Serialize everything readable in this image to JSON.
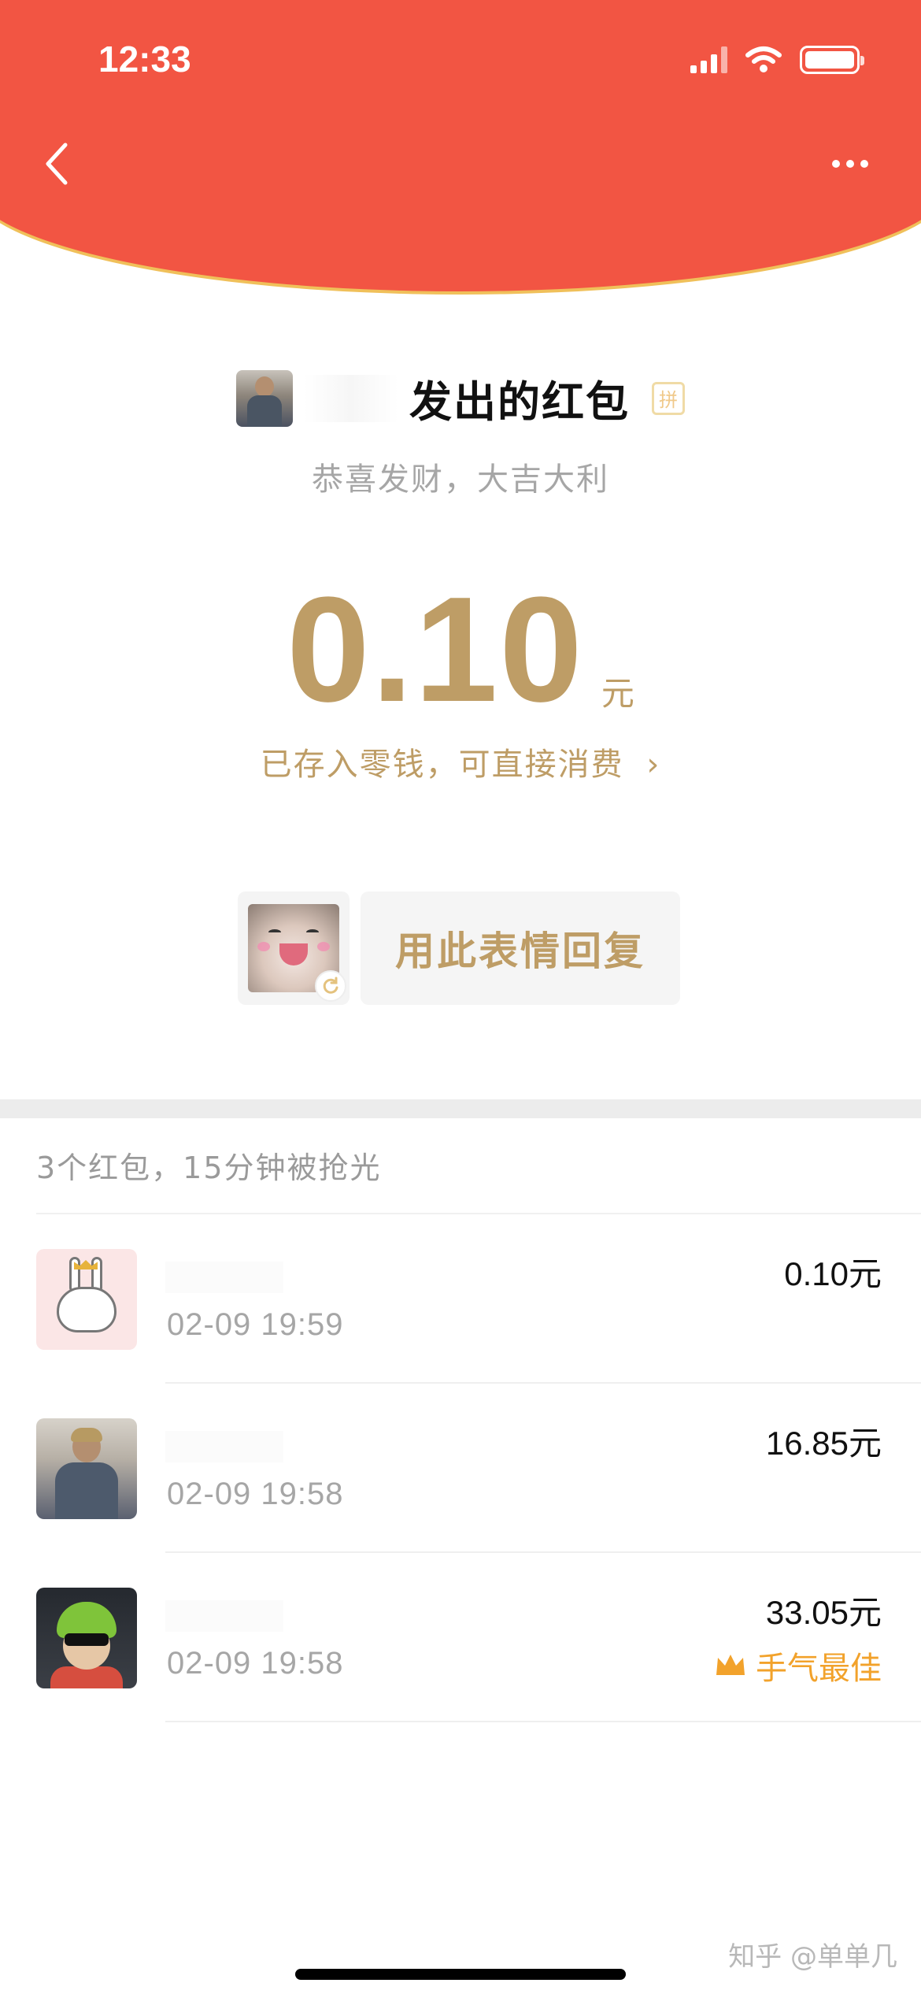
{
  "status_bar": {
    "time": "12:33"
  },
  "sender": {
    "title": "发出的红包",
    "badge": "拼",
    "blessing": "恭喜发财，大吉大利"
  },
  "amount": {
    "value": "0.10",
    "unit": "元"
  },
  "deposit_link": {
    "label": "已存入零钱，可直接消费",
    "chevron": "›"
  },
  "sticker_reply": {
    "label": "用此表情回复"
  },
  "summary": {
    "text": "3个红包，15分钟被抢光"
  },
  "records": [
    {
      "avatar_icon": "rabbit-avatar",
      "time": "02-09 19:59",
      "amount": "0.10元"
    },
    {
      "avatar_icon": "man-avatar",
      "time": "02-09 19:58",
      "amount": "16.85元"
    },
    {
      "avatar_icon": "rapper-avatar",
      "time": "02-09 19:58",
      "amount": "33.05元",
      "best_label": "手气最佳"
    }
  ],
  "watermark": "知乎 @单单几",
  "colors": {
    "header_red": "#F25543",
    "gold": "#BE9D66",
    "best_orange": "#F2A22B"
  }
}
